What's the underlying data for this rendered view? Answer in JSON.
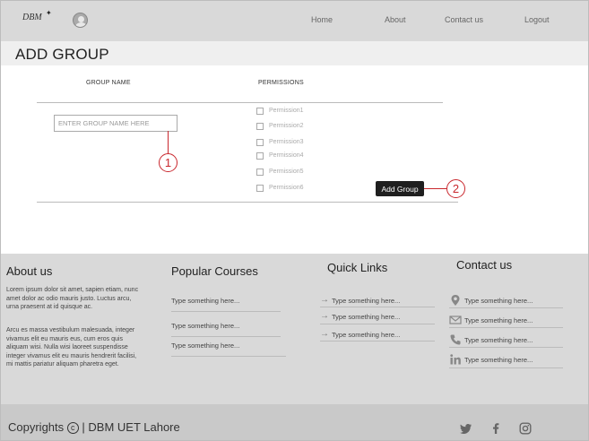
{
  "header": {
    "logo": "DBM",
    "nav": [
      "Home",
      "About",
      "Contact us",
      "Logout"
    ]
  },
  "page_title": "ADD GROUP",
  "form": {
    "group_name_header": "GROUP  NAME",
    "permissions_header": "PERMISSIONS",
    "group_name_placeholder": "ENTER GROUP NAME HERE",
    "permissions": [
      "Permission1",
      "Permission2",
      "Permission3",
      "Permission4",
      "Permission5",
      "Permission6"
    ],
    "add_button": "Add Group",
    "annotation_1": "1",
    "annotation_2": "2"
  },
  "footer": {
    "about": {
      "title": "About us",
      "para1": "Lorem ipsum dolor sit amet, sapien etiam, nunc amet dolor ac odio mauris justo. Luctus arcu, urna praesent at id quisque ac.",
      "para2": "Arcu es massa vestibulum malesuada, integer vivamus elit eu mauris eus, cum eros quis aliquam wisi. Nulla wisi laoreet suspendisse integer vivamus elit eu mauris hendrerit facilisi, mi mattis pariatur aliquam pharetra eget."
    },
    "courses": {
      "title": "Popular Courses",
      "items": [
        "Type something here...",
        "Type something here...",
        "Type something here..."
      ]
    },
    "quick_links": {
      "title": "Quick Links",
      "items": [
        "Type something here...",
        "Type something here...",
        "Type something here..."
      ]
    },
    "contact": {
      "title": "Contact us",
      "items": [
        "Type something here...",
        "Type something here...",
        "Type something here...",
        "Type something here..."
      ],
      "icons": [
        "location-icon",
        "envelope-icon",
        "phone-icon",
        "linkedin-icon"
      ]
    },
    "copyright_prefix": "Copyrights",
    "copyright_symbol": "c",
    "copyright_suffix": "| DBM UET Lahore",
    "social_icons": [
      "twitter-icon",
      "facebook-icon",
      "instagram-icon"
    ]
  },
  "colors": {
    "header_bg": "#d9d9d9",
    "footer_bg": "#d9d9d9",
    "bottom_bg": "#c9c9c9",
    "button_bg": "#1f1f1f",
    "annotation": "#c9272d"
  }
}
